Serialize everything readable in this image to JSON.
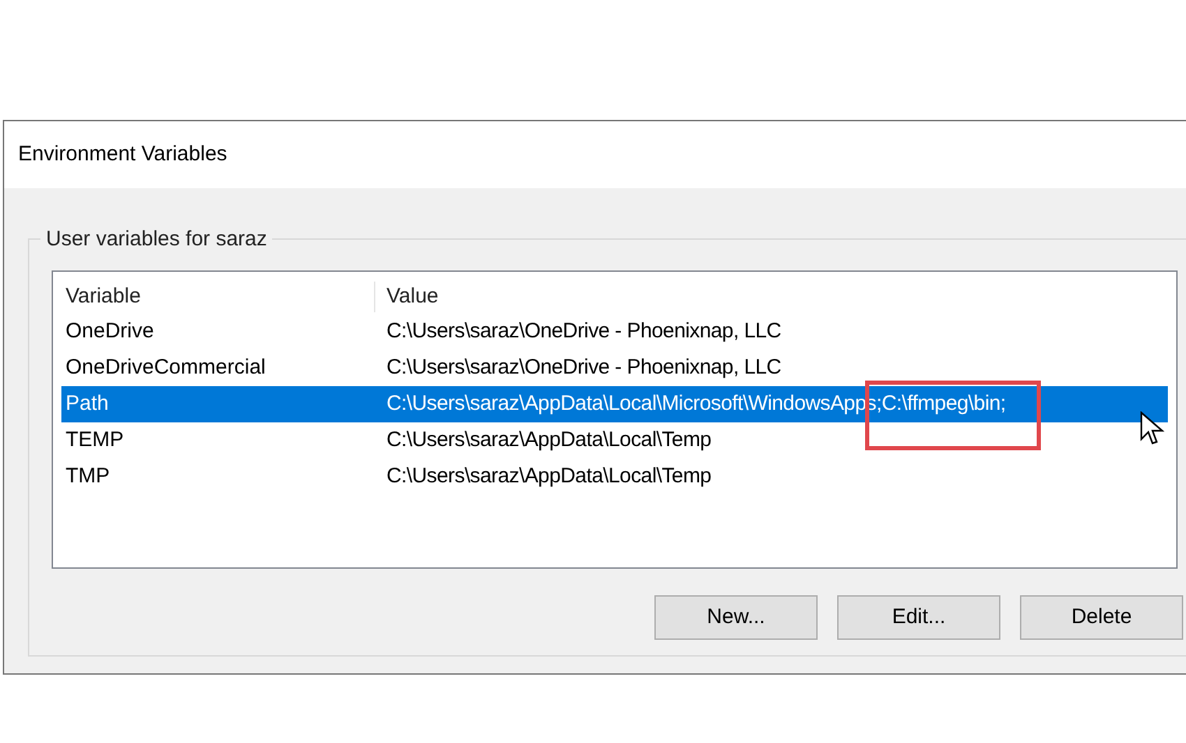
{
  "window": {
    "title": "Environment Variables"
  },
  "group": {
    "label": "User variables for saraz"
  },
  "table": {
    "columns": [
      "Variable",
      "Value"
    ],
    "rows": [
      {
        "variable": "OneDrive",
        "value": "C:\\Users\\saraz\\OneDrive - Phoenixnap, LLC",
        "selected": false
      },
      {
        "variable": "OneDriveCommercial",
        "value": "C:\\Users\\saraz\\OneDrive - Phoenixnap, LLC",
        "selected": false
      },
      {
        "variable": "Path",
        "value": "C:\\Users\\saraz\\AppData\\Local\\Microsoft\\WindowsApps",
        "highlighted_value": ";C:\\ffmpeg\\bin;",
        "selected": true
      },
      {
        "variable": "TEMP",
        "value": "C:\\Users\\saraz\\AppData\\Local\\Temp",
        "selected": false
      },
      {
        "variable": "TMP",
        "value": "C:\\Users\\saraz\\AppData\\Local\\Temp",
        "selected": false
      }
    ]
  },
  "buttons": [
    "New...",
    "Edit...",
    "Delete"
  ]
}
